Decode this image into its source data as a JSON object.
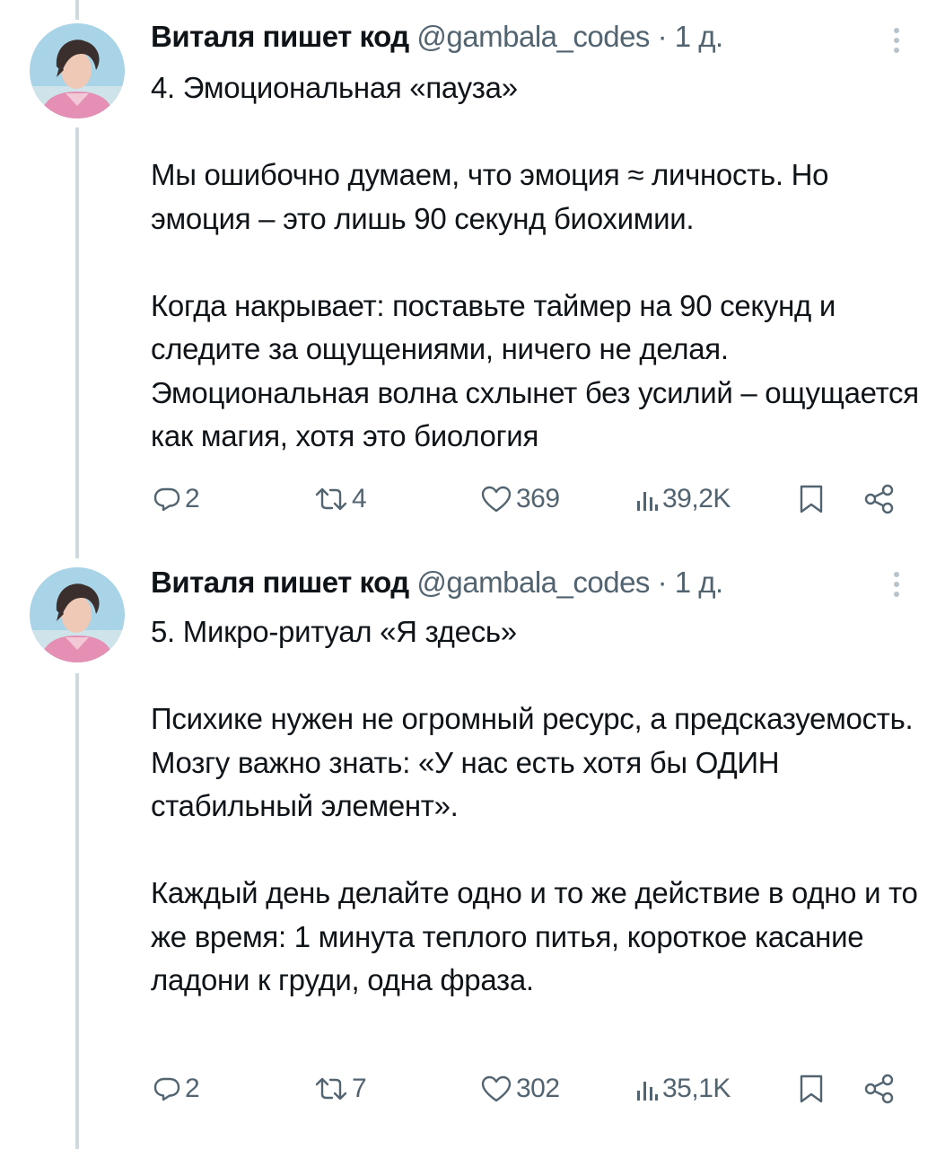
{
  "tweets": [
    {
      "author_name": "Виталя пишет код",
      "handle": "@gambala_codes",
      "separator": "·",
      "time": "1 д.",
      "text": "4. Эмоциональная «пауза»\n\nМы ошибочно думаем, что эмоция ≈ личность. Но эмоция – это лишь 90 секунд биохимии.\n\nКогда накрывает: поставьте таймер на 90 секунд и следите за ощущениями, ничего не делая.\nЭмоциональная волна схлынет без усилий – ощущается как магия, хотя это биология",
      "replies": "2",
      "reposts": "4",
      "likes": "369",
      "views": "39,2K"
    },
    {
      "author_name": "Виталя пишет код",
      "handle": "@gambala_codes",
      "separator": "·",
      "time": "1 д.",
      "text": "5. Микро-ритуал «Я здесь»\n\nПсихике нужен не огромный ресурс, а предсказуемость.\nМозгу важно знать: «У нас есть хотя бы ОДИН стабильный элемент».\n\nКаждый день делайте одно и то же действие в одно и то же время: 1 минута теплого питья, короткое касание ладони к груди, одна фраза.",
      "replies": "2",
      "reposts": "7",
      "likes": "302",
      "views": "35,1K"
    }
  ],
  "icons": {
    "reply": "reply-icon",
    "repost": "repost-icon",
    "like": "heart-icon",
    "views": "views-icon",
    "bookmark": "bookmark-icon",
    "share": "share-icon",
    "more": "more-dots-icon"
  },
  "colors": {
    "text": "#0f1419",
    "secondary": "#536471",
    "thread_line": "#cfd9de"
  }
}
